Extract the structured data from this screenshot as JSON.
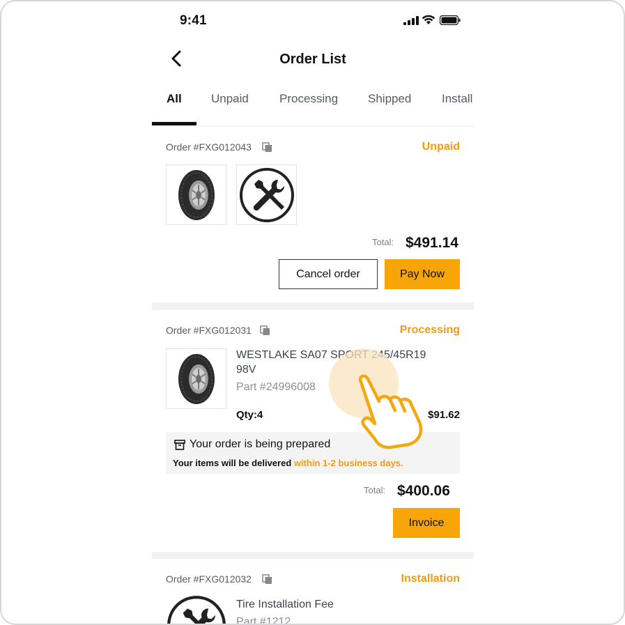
{
  "status_bar": {
    "time": "9:41"
  },
  "header": {
    "title": "Order List"
  },
  "tabs": [
    {
      "label": "All",
      "active": true
    },
    {
      "label": "Unpaid",
      "active": false
    },
    {
      "label": "Processing",
      "active": false
    },
    {
      "label": "Shipped",
      "active": false
    },
    {
      "label": "Install",
      "active": false
    }
  ],
  "orders": [
    {
      "order_no": "Order #FXG012043",
      "status": "Unpaid",
      "items_icons": [
        "tire-image",
        "tools-icon"
      ],
      "total_label": "Total:",
      "total": "$491.14",
      "buttons": {
        "cancel": "Cancel order",
        "pay": "Pay Now"
      }
    },
    {
      "order_no": "Order #FXG012031",
      "status": "Processing",
      "product": {
        "name": "WESTLAKE SA07 SPORT 245/45R19 98V",
        "part": "Part #24996008",
        "qty": "Qty:4",
        "price": "$91.62"
      },
      "notice": {
        "title": "Your order is being prepared",
        "text": "Your items will be delivered ",
        "highlight": "within 1-2 business days."
      },
      "total_label": "Total:",
      "total": "$400.06",
      "buttons": {
        "invoice": "Invoice"
      }
    },
    {
      "order_no": "Order #FXG012032",
      "status": "Installation",
      "product": {
        "name": "Tire Installation Fee",
        "part": "Part #1212"
      }
    }
  ],
  "colors": {
    "accent": "#f7a508",
    "status_orange": "#f39a12",
    "background": "#f2f2f2"
  }
}
